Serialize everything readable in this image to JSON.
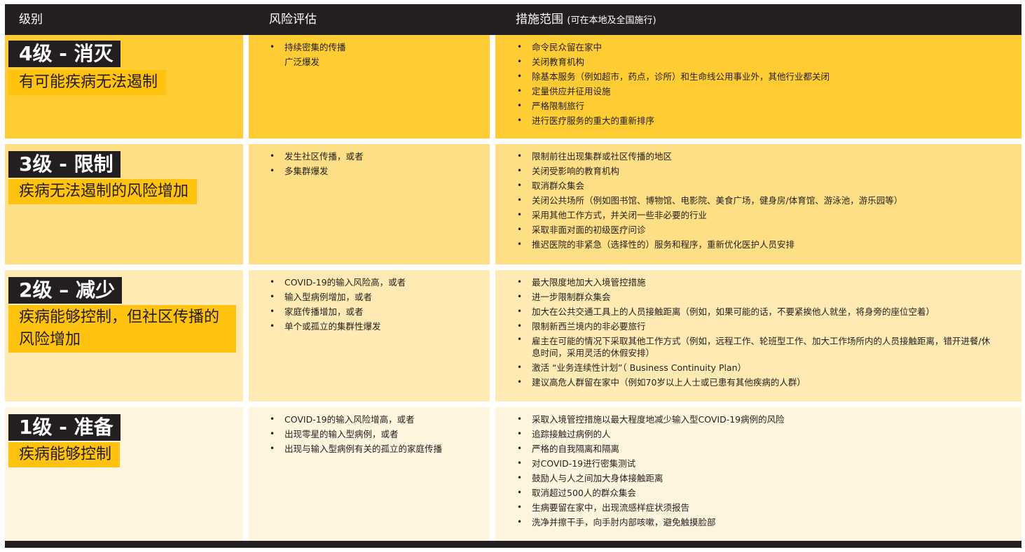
{
  "headers": {
    "col1": "级别",
    "col2": "风险评估",
    "col3": "措施范围",
    "col3_sub": "(可在本地及全国施行)"
  },
  "levels": [
    {
      "level": "4级 - 消灭",
      "description": "有可能疾病无法遏制",
      "risk": [
        "持续密集的传播",
        "广泛爆发"
      ],
      "measures": [
        "命令民众留在家中",
        "关闭教育机构",
        "除基本服务（例如超市，药点，诊所）和生命线公用事业外，其他行业都关闭",
        "定量供应并征用设施",
        "严格限制旅行",
        "进行医疗服务的重大的重新排序"
      ],
      "color": "#ffcd33"
    },
    {
      "level": "3级 - 限制",
      "description": "疾病无法遏制的风险增加",
      "risk": [
        "发生社区传播，或者",
        "多集群爆发"
      ],
      "measures": [
        "限制前往出现集群或社区传播的地区",
        "关闭受影响的教育机构",
        "取消群众集会",
        "关闭公共场所（例如图书馆、博物馆、电影院、美食广场，健身房/体育馆、游泳池，游乐园等）",
        "采用其他工作方式，并关闭一些非必要的行业",
        "采取非面对面的初级医疗问诊",
        "推迟医院的非紧急（选择性的）服务和程序，重新优化医护人员安排"
      ],
      "color": "#ffdf85"
    },
    {
      "level": "2级 – 减少",
      "description": "疾病能够控制，但社区传播的风险增加",
      "risk": [
        "COVID-19的输入风险高，或者",
        "输入型病例增加，或者",
        "家庭传播增加，或者",
        "单个或孤立的集群性爆发"
      ],
      "measures": [
        "最大限度地加大入境管控措施",
        "进一步限制群众集会",
        "加大在公共交通工具上的人员接触距离（例如，如果可能的话，不要紧挨他人就坐，将身旁的座位空着）",
        "限制新西兰境内的非必要旅行",
        "雇主在可能的情况下采取其他工作方式（例如，远程工作、轮班型工作、加大工作场所内的人员接触距离，错开进餐/休息时间，采用灵活的休假安排）",
        "激活 “业务连续性计划”（ Business Continuity Plan）",
        "建议高危人群留在家中（例如70岁以上人士或已患有其他疾病的人群）"
      ],
      "color": "#ffeab4"
    },
    {
      "level": "1级 - 准备",
      "description": "疾病能够控制",
      "risk": [
        "COVID-19的输入风险增高，或者",
        "出现零星的输入型病例，或者",
        "出现与输入型病例有关的孤立的家庭传播"
      ],
      "measures": [
        "采取入境管控措施以最大程度地减少输入型COVID-19病例的风险",
        "追踪接触过病例的人",
        "严格的自我隔离和隔离",
        "对COVID-19进行密集测试",
        "鼓励人与人之间加大身体接触距离",
        "取消超过500人的群众集会",
        "生病要留在家中，出现流感样症状须报告",
        "洗净并擦干手，向手肘内部咳嗽，避免触摸脸部"
      ],
      "color": "#fff5de"
    }
  ]
}
